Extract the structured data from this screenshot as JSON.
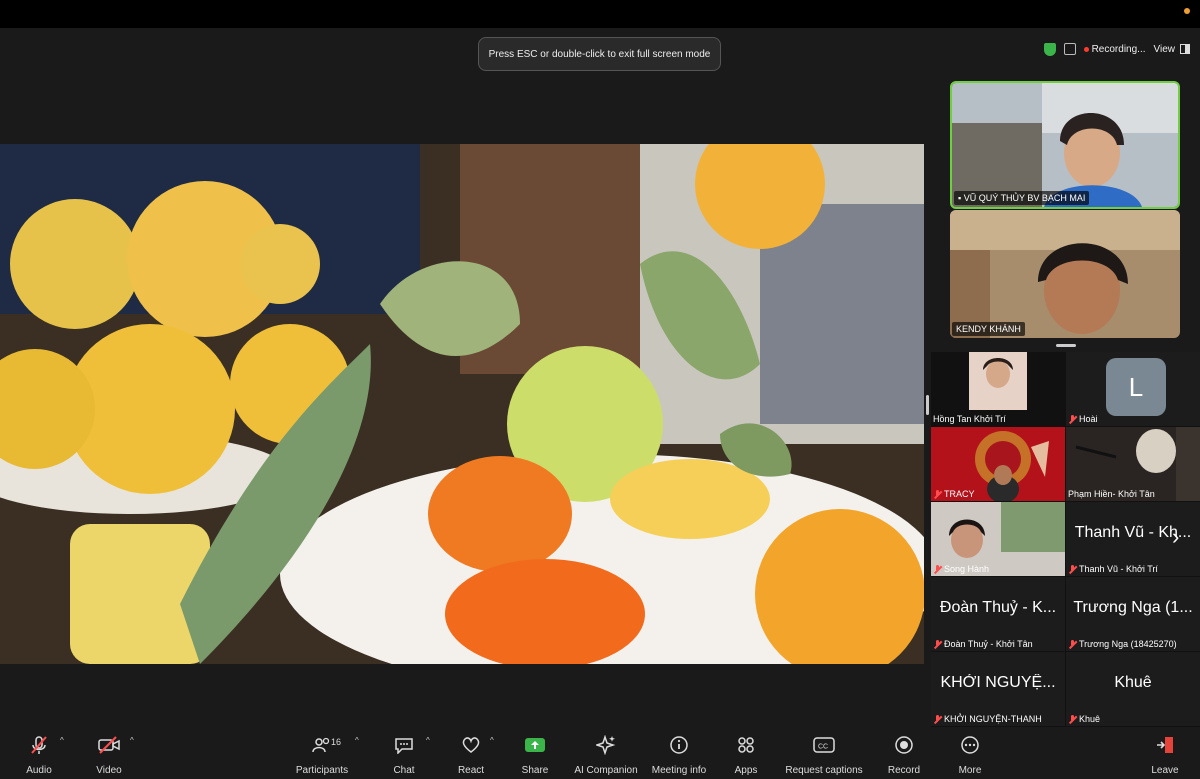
{
  "banner": {
    "text": "Press ESC or double-click to exit full screen mode"
  },
  "status": {
    "recording": "Recording...",
    "view": "View"
  },
  "top_tiles": [
    {
      "name": "VŨ QUÝ THỦY BV BẠCH MAI",
      "pinned": true,
      "active": true
    },
    {
      "name": "KENDY KHÁNH",
      "pinned": false,
      "active": false
    }
  ],
  "gallery": [
    {
      "name": "Hồng Tan Khởi Trí",
      "muted": false,
      "kind": "photo"
    },
    {
      "name": "Hoài",
      "muted": true,
      "kind": "avatar",
      "avatar_letter": "L"
    },
    {
      "name": "TRACY",
      "muted": true,
      "kind": "video"
    },
    {
      "name": "Phạm Hiền- Khởi Tân",
      "muted": false,
      "kind": "video"
    },
    {
      "name": "Song Hành",
      "muted": true,
      "kind": "video"
    },
    {
      "name": "Thanh Vũ - Khởi Trí",
      "muted": true,
      "kind": "text",
      "display": "Thanh Vũ - Kh..."
    },
    {
      "name": "Đoàn Thuỷ - Khởi Tân",
      "muted": true,
      "kind": "text",
      "display": "Đoàn Thuỷ - K..."
    },
    {
      "name": "Trương Nga (18425270)",
      "muted": true,
      "kind": "text",
      "display": "Trương Nga (1..."
    },
    {
      "name": "KHỞI NGUYỆN-THANH",
      "muted": true,
      "kind": "text",
      "display": "KHỞI NGUYỆ..."
    },
    {
      "name": "Khuê",
      "muted": true,
      "kind": "text",
      "display": "Khuê"
    }
  ],
  "toolbar": {
    "audio": "Audio",
    "video": "Video",
    "participants": "Participants",
    "participants_count": "16",
    "chat": "Chat",
    "react": "React",
    "share": "Share",
    "ai_companion": "AI Companion",
    "meeting_info": "Meeting info",
    "apps": "Apps",
    "captions": "Request captions",
    "record": "Record",
    "more": "More",
    "leave": "Leave"
  },
  "colors": {
    "active_border": "#6fcf3e",
    "share_green": "#3bb54a",
    "muted_red": "#ff4d4d",
    "leave_red": "#e5433a"
  }
}
